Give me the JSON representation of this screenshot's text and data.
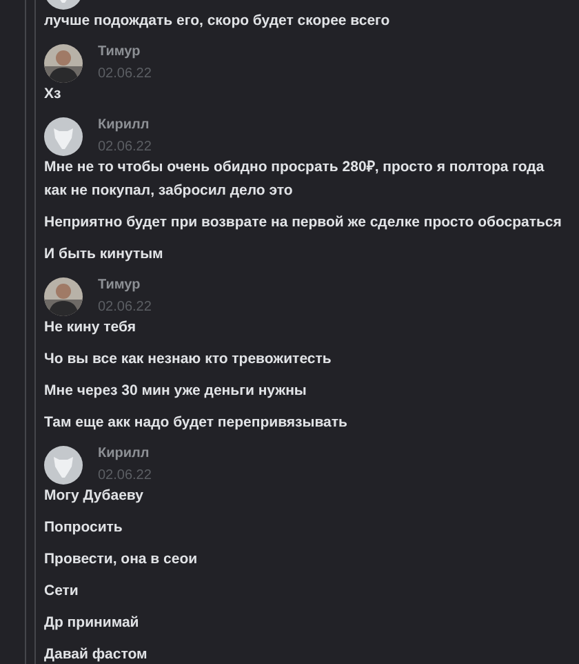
{
  "groups": [
    {
      "avatar": {
        "kind": "default"
      },
      "messages": [
        "лучше подождать его, скоро будет скорее всего"
      ]
    },
    {
      "author": "Тимур",
      "date": "02.06.22",
      "avatar": {
        "kind": "photo"
      },
      "messages": [
        "Хз"
      ]
    },
    {
      "author": "Кирилл",
      "date": "02.06.22",
      "avatar": {
        "kind": "default"
      },
      "messages": [
        "Мне не то чтобы очень обидно просрать 280₽, просто я полтора года как не покупал, забросил дело это",
        "Неприятно будет при возврате на первой же сделке просто обосраться",
        "И быть кинутым"
      ]
    },
    {
      "author": "Тимур",
      "date": "02.06.22",
      "avatar": {
        "kind": "photo"
      },
      "messages": [
        "Не кину тебя",
        "Чо вы все как незнаю кто тревожитесть",
        "Мне через 30 мин уже деньги нужны",
        "Там еще акк надо будет перепривязывать"
      ]
    },
    {
      "author": "Кирилл",
      "date": "02.06.22",
      "avatar": {
        "kind": "default"
      },
      "messages": [
        "Могу Дубаеву",
        "Попросить",
        "Провести, она в сеои",
        "Сети",
        "Др принимай",
        "Давай фастом"
      ]
    }
  ]
}
